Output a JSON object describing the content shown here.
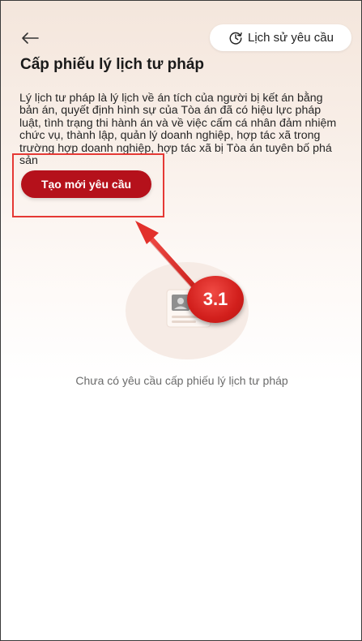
{
  "header": {
    "history_label": "Lịch sử yêu cầu"
  },
  "page": {
    "title": "Cấp phiếu lý lịch tư pháp",
    "description": "Lý lịch tư pháp là lý lịch về án tích của người bị kết án bằng bản án, quyết định hình sự của Tòa án đã có hiệu lực pháp luật, tình trạng thi hành án và về việc cấm cá nhân đảm nhiệm chức vụ, thành lập, quản lý doanh nghiệp, hợp tác xã trong trường hợp doanh nghiệp, hợp tác xã bị Tòa án tuyên bố phá sản",
    "create_button_label": "Tạo mới yêu cầu",
    "empty_state_text": "Chưa có yêu cầu cấp phiếu lý lịch tư pháp"
  },
  "annotation": {
    "step_label": "3.1",
    "color": "#e53935"
  },
  "colors": {
    "primary": "#b5111b",
    "badge": "#d21f1c"
  }
}
